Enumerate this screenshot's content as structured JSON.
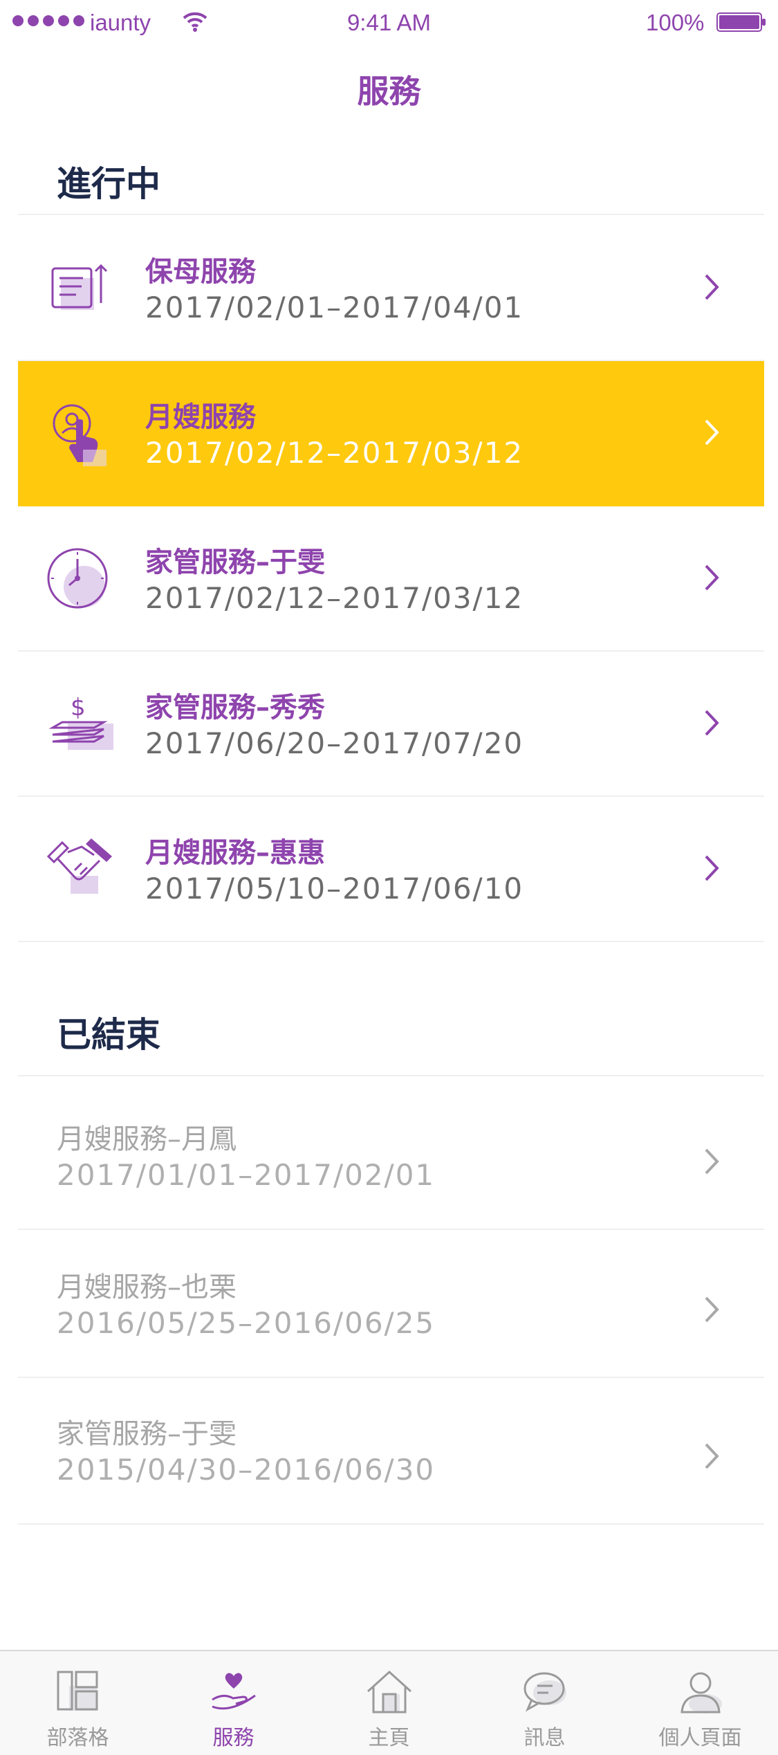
{
  "status_bar": {
    "carrier": "iaunty",
    "time": "9:41 AM",
    "battery": "100%"
  },
  "nav": {
    "title": "服務"
  },
  "colors": {
    "accent": "#8E44AD",
    "highlight": "#FFC90E",
    "header_text": "#1E2A4A",
    "muted_text": "#A6A6A6"
  },
  "ongoing": {
    "header": "進行中",
    "items": [
      {
        "title": "保母服務",
        "dates": "2017/02/01–2017/04/01",
        "icon": "document-upload-icon"
      },
      {
        "title": "月嫂服務",
        "dates": "2017/02/12–2017/03/12",
        "icon": "user-touch-icon",
        "highlighted": true
      },
      {
        "title": "家管服務–于雯",
        "dates": "2017/02/12–2017/03/12",
        "icon": "clock-icon"
      },
      {
        "title": "家管服務–秀秀",
        "dates": "2017/06/20–2017/07/20",
        "icon": "money-stack-icon"
      },
      {
        "title": "月嫂服務–惠惠",
        "dates": "2017/05/10–2017/06/10",
        "icon": "handshake-icon"
      }
    ]
  },
  "ended": {
    "header": "已結束",
    "items": [
      {
        "title": "月嫂服務–月鳳",
        "dates": "2017/01/01–2017/02/01"
      },
      {
        "title": "月嫂服務–也栗",
        "dates": "2016/05/25–2016/06/25"
      },
      {
        "title": "家管服務–于雯",
        "dates": "2015/04/30–2016/06/30"
      }
    ]
  },
  "tabbar": {
    "tabs": [
      {
        "label": "部落格",
        "icon": "blog-icon"
      },
      {
        "label": "服務",
        "icon": "heart-hand-icon",
        "active": true
      },
      {
        "label": "主頁",
        "icon": "home-icon"
      },
      {
        "label": "訊息",
        "icon": "chat-icon"
      },
      {
        "label": "個人頁面",
        "icon": "profile-icon"
      }
    ]
  }
}
